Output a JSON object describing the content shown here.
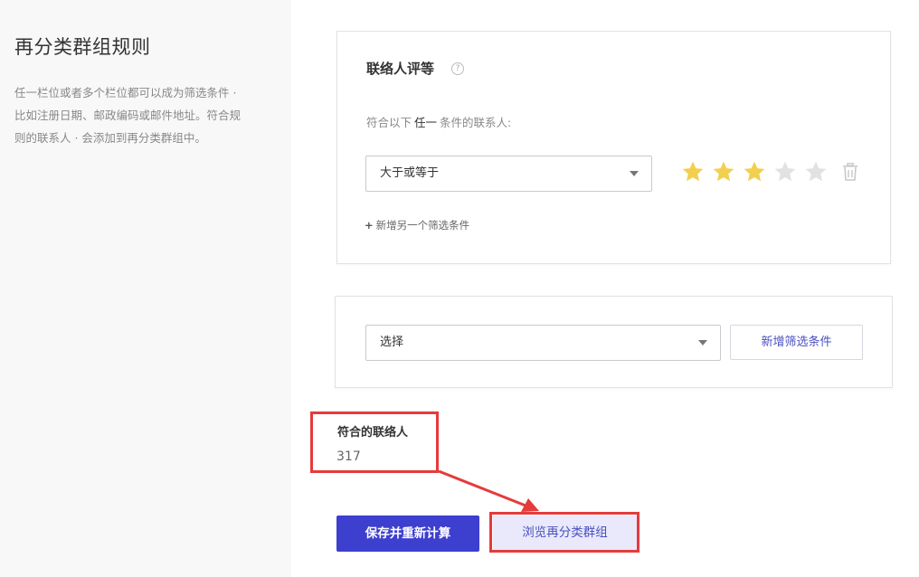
{
  "sidebar": {
    "title": "再分类群组规则",
    "description": "任一栏位或者多个栏位都可以成为筛选条件 · 比如注册日期、邮政编码或邮件地址。符合规则的联系人 · 会添加到再分类群组中。"
  },
  "rating_card": {
    "title": "联络人评等",
    "help_icon": "?",
    "match_prefix": "符合以下",
    "match_keyword": "任一",
    "match_suffix": "条件的联系人:",
    "operator_value": "大于或等于",
    "rating": 3,
    "rating_max": 5,
    "star_filled_color": "#f2cf4f",
    "star_empty_color": "#e2e2e5",
    "add_condition_plus": "+",
    "add_condition_label": "新增另一个筛选条件"
  },
  "filter_card": {
    "select_value": "选择",
    "add_filter_button": "新增筛选条件"
  },
  "result": {
    "label": "符合的联络人",
    "count": "317"
  },
  "actions": {
    "save_recalc": "保存并重新计算",
    "browse_group": "浏览再分类群组"
  },
  "colors": {
    "primary": "#3d3fcf",
    "highlight": "#e53b3b"
  }
}
